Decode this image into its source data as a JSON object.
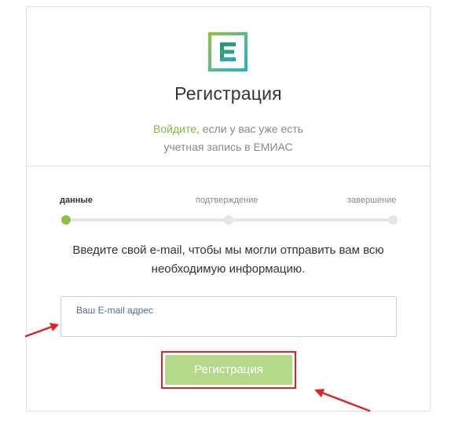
{
  "header": {
    "logo_letter": "E",
    "title": "Регистрация",
    "login_link_label": "Войдите",
    "login_text_line1": ", если у вас уже есть",
    "login_text_line2": "учетная запись в ЕМИАС"
  },
  "steps": {
    "items": [
      {
        "label": "данные",
        "active": true
      },
      {
        "label": "подтверждение",
        "active": false
      },
      {
        "label": "завершение",
        "active": false
      }
    ]
  },
  "form": {
    "instructions_line1": "Введите свой e-mail, чтобы мы могли отправить вам всю",
    "instructions_line2": "необходимую информацию.",
    "email_placeholder": "Ваш E-mail адрес",
    "email_value": "",
    "submit_label": "Регистрация"
  },
  "colors": {
    "accent_green": "#8bc34a",
    "link_green": "#7ebd3a",
    "button_green": "#b5d98b",
    "annotation_red": "#e02424",
    "logo_gradient_start": "#7ec64a",
    "logo_gradient_end": "#2cb7c9"
  },
  "icons": {
    "logo": "emias-logo-icon",
    "annotation_arrows": "red-arrow-icon"
  }
}
